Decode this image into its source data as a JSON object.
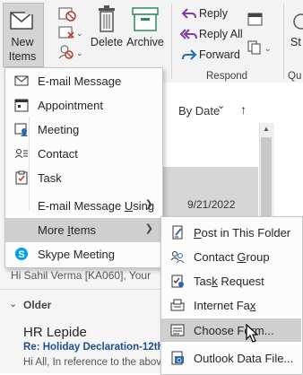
{
  "ribbon": {
    "new_items_line1": "New",
    "new_items_line2": "Items",
    "delete_label": "Delete",
    "archive_label": "Archive",
    "reply_label": "Reply",
    "reply_all_label": "Reply All",
    "forward_label": "Forward",
    "respond_group_label": "Respond",
    "cut_st": "St",
    "cut_qu": "Qu"
  },
  "new_items_menu": [
    {
      "label": "E-mail Message",
      "icon": "envelope-icon"
    },
    {
      "label": "Appointment",
      "icon": "calendar-icon"
    },
    {
      "label": "Meeting",
      "icon": "meeting-icon"
    },
    {
      "label": "Contact",
      "icon": "contact-card-icon"
    },
    {
      "label": "Task",
      "icon": "task-clipboard-icon"
    },
    {
      "label": "E-mail Message Using",
      "icon": "",
      "has_submenu": true
    },
    {
      "label": "More Items",
      "icon": "",
      "has_submenu": true,
      "highlighted": true
    },
    {
      "label": "Skype Meeting",
      "icon": "skype-icon"
    }
  ],
  "more_items_menu": [
    {
      "label": "Post in This Folder",
      "icon": "post-icon"
    },
    {
      "label": "Contact Group",
      "icon": "contact-group-icon"
    },
    {
      "label": "Task Request",
      "icon": "task-request-icon"
    },
    {
      "label": "Internet Fax",
      "icon": "fax-icon"
    },
    {
      "label": "Choose Form...",
      "icon": "form-icon",
      "highlighted": true
    },
    {
      "label": "Outlook Data File...",
      "icon": "data-file-icon"
    }
  ],
  "mail_list": {
    "sort_label": "By Date",
    "sort_arrow": "↑",
    "date": "9/21/2022",
    "preview1": "Hi Sahil Verma [KA060], Your",
    "group_header": "Older",
    "sender": "HR Lepide",
    "subject": "Re: Holiday Declaration-12th ...",
    "preview2": "Hi All,  In reference to the abov..."
  },
  "colors": {
    "ribbon_bg": "#f3f3f3",
    "highlight": "#cfcfcf",
    "link_blue": "#1e4e8c",
    "accent_blue": "#2b6cb0",
    "green": "#2e8b57"
  }
}
